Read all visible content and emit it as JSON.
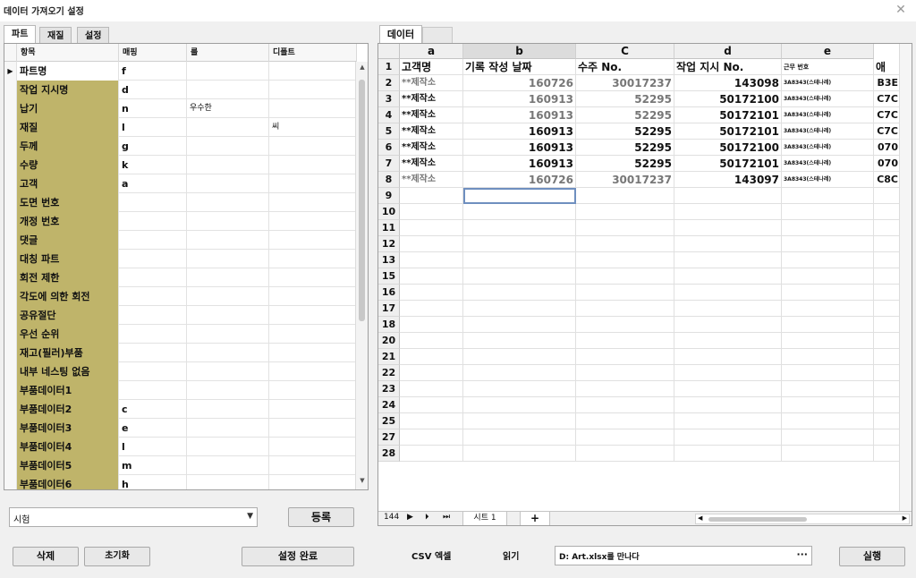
{
  "window": {
    "title": "데이터 가져오기 설정",
    "close": "✕"
  },
  "left_tabs": [
    "파트",
    "재질",
    "설정"
  ],
  "grid": {
    "headers": [
      "항목",
      "매핑",
      "룰",
      "디폴트"
    ],
    "rows": [
      {
        "name": "파트명",
        "map": "f",
        "rule": "",
        "def": ""
      },
      {
        "name": "작업 지시명",
        "map": "d",
        "rule": "",
        "def": ""
      },
      {
        "name": "납기",
        "map": "n",
        "rule": "우수한",
        "def": ""
      },
      {
        "name": "재질",
        "map": "l",
        "rule": "",
        "def": "씨"
      },
      {
        "name": "두께",
        "map": "g",
        "rule": "",
        "def": ""
      },
      {
        "name": "수량",
        "map": "k",
        "rule": "",
        "def": ""
      },
      {
        "name": "고객",
        "map": "a",
        "rule": "",
        "def": ""
      },
      {
        "name": "도면 번호",
        "map": "",
        "rule": "",
        "def": ""
      },
      {
        "name": "개정 번호",
        "map": "",
        "rule": "",
        "def": ""
      },
      {
        "name": "댓글",
        "map": "",
        "rule": "",
        "def": ""
      },
      {
        "name": "대칭 파트",
        "map": "",
        "rule": "",
        "def": ""
      },
      {
        "name": "회전 제한",
        "map": "",
        "rule": "",
        "def": ""
      },
      {
        "name": "각도에 의한 회전",
        "map": "",
        "rule": "",
        "def": ""
      },
      {
        "name": "공유절단",
        "map": "",
        "rule": "",
        "def": ""
      },
      {
        "name": "우선 순위",
        "map": "",
        "rule": "",
        "def": ""
      },
      {
        "name": "재고(필러)부품",
        "map": "",
        "rule": "",
        "def": ""
      },
      {
        "name": "내부 네스팅 없음",
        "map": "",
        "rule": "",
        "def": ""
      },
      {
        "name": "부품데이터1",
        "map": "",
        "rule": "",
        "def": ""
      },
      {
        "name": "부품데이터2",
        "map": "c",
        "rule": "",
        "def": ""
      },
      {
        "name": "부품데이터3",
        "map": "e",
        "rule": "",
        "def": ""
      },
      {
        "name": "부품데이터4",
        "map": "l",
        "rule": "",
        "def": ""
      },
      {
        "name": "부품데이터5",
        "map": "m",
        "rule": "",
        "def": ""
      },
      {
        "name": "부품데이터6",
        "map": "h",
        "rule": "",
        "def": ""
      }
    ]
  },
  "combo": {
    "value": "시험",
    "arrow": "▼"
  },
  "buttons": {
    "register": "등록",
    "delete": "삭제",
    "reset": "초기화",
    "done": "설정 완료",
    "run": "실행"
  },
  "csv_label": "CSV 엑셀",
  "read_label": "읽기",
  "file_path": "D: Art.xlsx를 만나다",
  "file_dots": "···",
  "right_tab": "데이터",
  "sheet": {
    "columns": [
      "a",
      "b",
      "C",
      "d",
      "e"
    ],
    "row_numbers": [
      "1",
      "2",
      "3",
      "4",
      "5",
      "6",
      "7",
      "8",
      "9",
      "10",
      "11",
      "12",
      "13",
      "15",
      "16",
      "17",
      "18",
      "20",
      "21",
      "22",
      "23",
      "24",
      "25",
      "27",
      "28"
    ],
    "data": [
      [
        "고객명",
        "기록 작성 날짜",
        "수주 No.",
        "작업 지시 No.",
        "근무 번호",
        "애"
      ],
      [
        "**제작소",
        "160726",
        "30017237",
        "143098",
        "3A8343(스테나레)",
        "B3E"
      ],
      [
        "**제작소",
        "160913",
        "52295",
        "50172100",
        "3A8343(스테나레)",
        "C7C"
      ],
      [
        "**제작소",
        "160913",
        "52295",
        "50172101",
        "3A8343(스테나레)",
        "C7C"
      ],
      [
        "**제작소",
        "160913",
        "52295",
        "50172101",
        "3A8343(스테나레)",
        "C7C"
      ],
      [
        "**제작소",
        "160913",
        "52295",
        "50172100",
        "3A8343(스테나레)",
        "070"
      ],
      [
        "**제작소",
        "160913",
        "52295",
        "50172101",
        "3A8343(스테나레)",
        "070"
      ],
      [
        "**제작소",
        "160726",
        "30017237",
        "143097",
        "3A8343(스테나레)",
        "C8C"
      ]
    ],
    "sheet_nav": [
      "144",
      "▶",
      "⏵",
      "⏭"
    ],
    "sheet_tab": "시트 1",
    "add_sheet": "+",
    "scroll_left": "◀",
    "scroll_right": "▶"
  }
}
